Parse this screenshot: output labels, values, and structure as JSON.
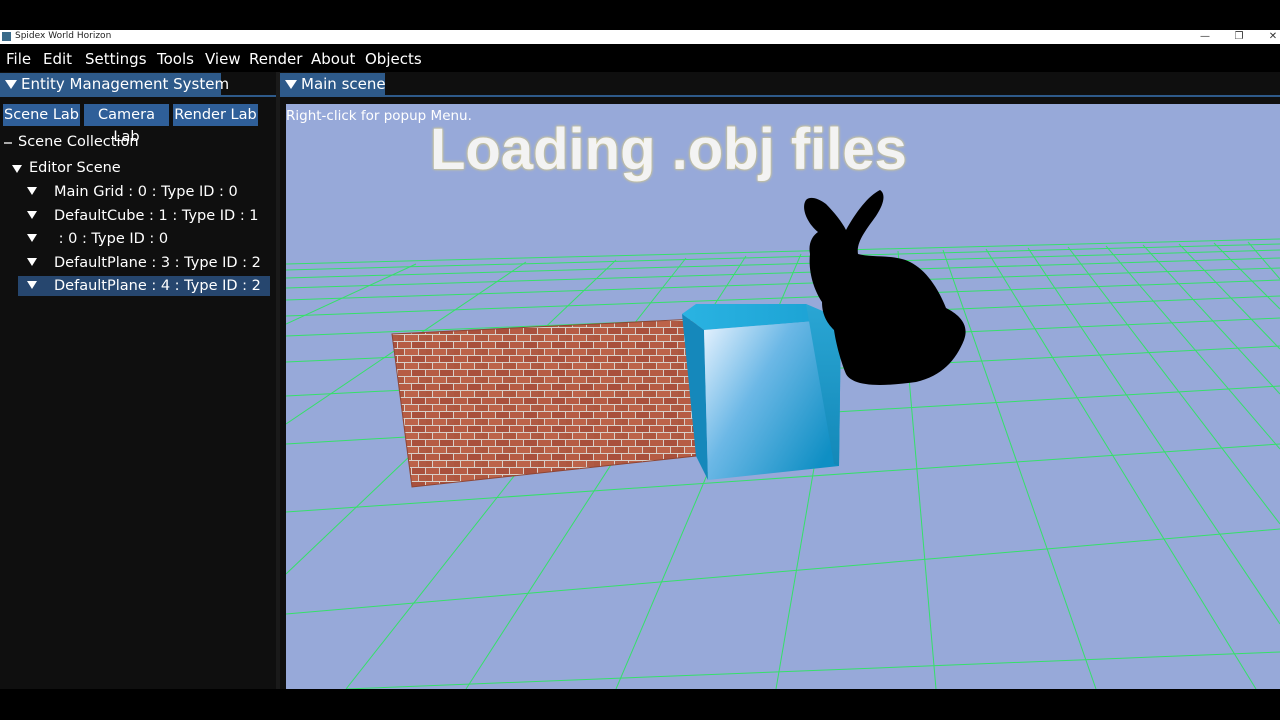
{
  "window": {
    "title": "Spidex World Horizon",
    "controls": [
      "—",
      "❐",
      "✕"
    ]
  },
  "menu": [
    "File",
    "Edit",
    "Settings",
    "Tools",
    "View",
    "Render",
    "About",
    "Objects"
  ],
  "left_panel": {
    "title": "Entity Management System",
    "tabs": [
      "Scene Lab",
      "Camera Lab",
      "Render Lab"
    ],
    "collection_header": "Scene Collection",
    "root": "Editor Scene",
    "entities": [
      "Main Grid : 0 : Type ID : 0",
      "DefaultCube : 1 : Type ID : 1",
      " : 0 : Type ID : 0",
      "DefaultPlane : 3 : Type ID : 2",
      "DefaultPlane : 4 : Type ID : 2"
    ]
  },
  "right_panel": {
    "title": "Main scene",
    "hint": "Right-click for popup Menu.",
    "overlay_text": "Loading .obj files"
  },
  "colors": {
    "panel_tab": "#2e5a8a",
    "selection": "#26466e",
    "viewport_bg": "#97a9d9",
    "grid": "#35e06a",
    "brick": "#b65c44",
    "cube": "#1e9fd0"
  }
}
